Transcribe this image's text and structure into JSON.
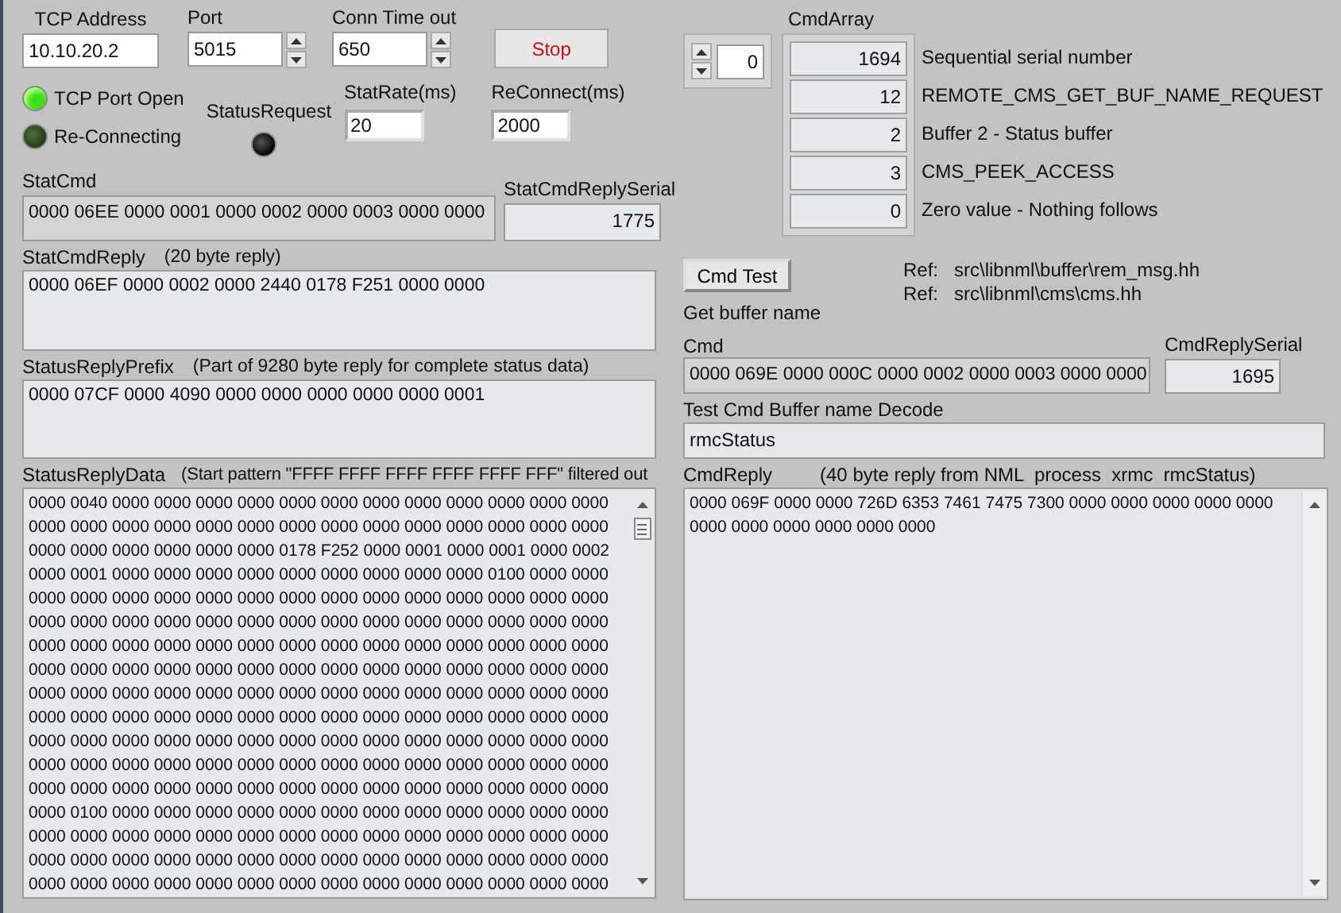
{
  "connection": {
    "tcp_address": {
      "label": "TCP Address",
      "value": "10.10.20.2"
    },
    "port": {
      "label": "Port",
      "value": "5015"
    },
    "conn_timeout": {
      "label": "Conn Time out",
      "value": "650"
    },
    "stop_button": "Stop"
  },
  "leds": [
    {
      "label": "TCP Port Open",
      "on": true
    },
    {
      "label": "Re-Connecting",
      "on": false
    }
  ],
  "status_request": {
    "label": "StatusRequest",
    "on": false
  },
  "stat_rate": {
    "label": "StatRate(ms)",
    "value": "20"
  },
  "reconnect": {
    "label": "ReConnect(ms)",
    "value": "2000"
  },
  "stat_cmd": {
    "label": "StatCmd",
    "value": "0000 06EE 0000 0001 0000 0002 0000 0003 0000 0000"
  },
  "stat_cmd_reply_serial": {
    "label": "StatCmdReplySerial",
    "value": "1775"
  },
  "stat_cmd_reply": {
    "label": "StatCmdReply",
    "note": "(20 byte reply)",
    "lines": [
      "0000 06EF 0000 0002 0000 2440 0178 F251 0000 0000"
    ]
  },
  "status_reply_prefix": {
    "label": "StatusReplyPrefix",
    "note": "(Part of 9280 byte reply for complete status data)",
    "lines": [
      "0000 07CF 0000 4090 0000 0000 0000 0000 0000 0001"
    ]
  },
  "status_reply_data": {
    "label": "StatusReplyData",
    "note": "(Start pattern \"FFFF FFFF FFFF FFFF FFFF FFF\" filtered out",
    "lines": [
      "0000 0040 0000 0000 0000 0000 0000 0000 0000 0000 0000 0000 0000 0000",
      "0000 0000 0000 0000 0000 0000 0000 0000 0000 0000 0000 0000 0000 0000",
      "0000 0000 0000 0000 0000 0000 0178 F252 0000 0001 0000 0001 0000 0002",
      "0000 0001 0000 0000 0000 0000 0000 0000 0000 0000 0000 0100 0000 0000",
      "0000 0000 0000 0000 0000 0000 0000 0000 0000 0000 0000 0000 0000 0000",
      "0000 0000 0000 0000 0000 0000 0000 0000 0000 0000 0000 0000 0000 0000",
      "0000 0000 0000 0000 0000 0000 0000 0000 0000 0000 0000 0000 0000 0000",
      "0000 0000 0000 0000 0000 0000 0000 0000 0000 0000 0000 0000 0000 0000",
      "0000 0000 0000 0000 0000 0000 0000 0000 0000 0000 0000 0000 0000 0000",
      "0000 0000 0000 0000 0000 0000 0000 0000 0000 0000 0000 0000 0000 0000",
      "0000 0000 0000 0000 0000 0000 0000 0000 0000 0000 0000 0000 0000 0000",
      "0000 0000 0000 0000 0000 0000 0000 0000 0000 0000 0000 0000 0000 0000",
      "0000 0000 0000 0000 0000 0000 0000 0000 0000 0000 0000 0000 0000 0000",
      "0000 0100 0000 0000 0000 0000 0000 0000 0000 0000 0000 0000 0000 0000",
      "0000 0000 0000 0000 0000 0000 0000 0000 0000 0000 0000 0000 0000 0000",
      "0000 0000 0000 0000 0000 0000 0000 0000 0000 0000 0000 0000 0000 0000",
      "0000 0000 0000 0000 0000 0000 0000 0000 0000 0000 0000 0000 0000 0000"
    ]
  },
  "cmd_array": {
    "label": "CmdArray",
    "index": "0",
    "items": [
      {
        "value": "1694",
        "description": "Sequential serial number"
      },
      {
        "value": "12",
        "description": "REMOTE_CMS_GET_BUF_NAME_REQUEST"
      },
      {
        "value": "2",
        "description": "Buffer 2 - Status buffer"
      },
      {
        "value": "3",
        "description": "CMS_PEEK_ACCESS"
      },
      {
        "value": "0",
        "description": "Zero value - Nothing follows"
      }
    ]
  },
  "cmd_test": {
    "button": "Cmd Test",
    "caption": "Get buffer name"
  },
  "refs": [
    {
      "label": "Ref:",
      "path": "src\\libnml\\buffer\\rem_msg.hh"
    },
    {
      "label": "Ref:",
      "path": "src\\libnml\\cms\\cms.hh"
    }
  ],
  "cmd": {
    "label": "Cmd",
    "value": "0000 069E 0000 000C 0000 0002 0000 0003 0000 0000"
  },
  "cmd_reply_serial": {
    "label": "CmdReplySerial",
    "value": "1695"
  },
  "decode": {
    "label": "Test Cmd Buffer name Decode",
    "value": "rmcStatus"
  },
  "cmd_reply": {
    "label": "CmdReply",
    "note": "(40 byte reply from NML  process  xrmc  rmcStatus)",
    "lines": [
      "0000 069F 0000 0000 726D 6353 7461 7475 7300 0000 0000 0000 0000 0000",
      "0000 0000 0000 0000 0000 0000"
    ]
  }
}
